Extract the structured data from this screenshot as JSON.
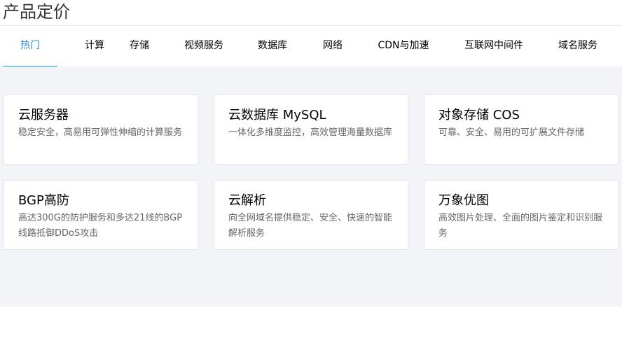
{
  "header": {
    "title": "产品定价"
  },
  "tabs": [
    {
      "label": "热门",
      "active": true
    },
    {
      "label": "计算"
    },
    {
      "label": "存储"
    },
    {
      "label": "视频服务"
    },
    {
      "label": "数据库"
    },
    {
      "label": "网络"
    },
    {
      "label": "CDN与加速"
    },
    {
      "label": "互联网中间件"
    },
    {
      "label": "域名服务"
    }
  ],
  "cards": [
    {
      "title": "云服务器",
      "desc": "稳定安全，高易用可弹性伸缩的计算服务"
    },
    {
      "title": "云数据库 MySQL",
      "desc": "一体化多维度监控，高效管理海量数据库"
    },
    {
      "title": "对象存储 COS",
      "desc": "可靠、安全、易用的可扩展文件存储"
    },
    {
      "title": "BGP高防",
      "desc": "高达300G的防护服务和多达21线的BGP线路抵御DDoS攻击"
    },
    {
      "title": "云解析",
      "desc": "向全网域名提供稳定、安全、快速的智能解析服务"
    },
    {
      "title": "万象优图",
      "desc": "高效图片处理、全面的图片鉴定和识别服务"
    }
  ],
  "colors": {
    "accent": "#1e9be7",
    "background": "#f3f4f7"
  }
}
